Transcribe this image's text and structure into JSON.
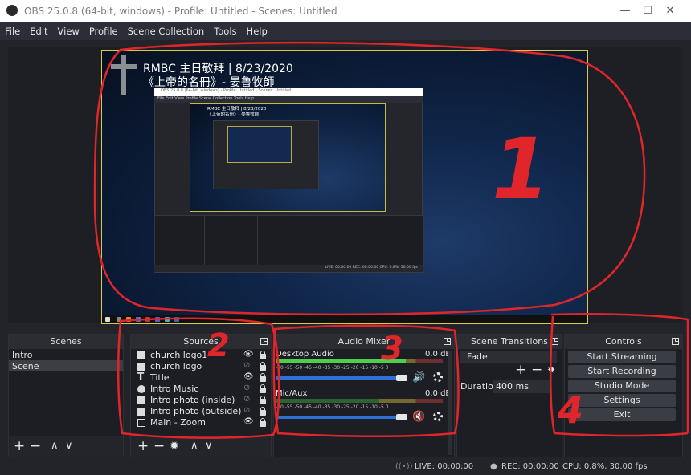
{
  "window": {
    "title": "OBS 25.0.8 (64-bit, windows) - Profile: Untitled - Scenes: Untitled",
    "controls": {
      "minimize": "—",
      "maximize": "☐",
      "close": "✕"
    }
  },
  "menu": [
    "File",
    "Edit",
    "View",
    "Profile",
    "Scene Collection",
    "Tools",
    "Help"
  ],
  "preview": {
    "title_line1": "RMBC 主日敬拜 | 8/23/2020",
    "title_line2": "《上帝的名冊》- 晏鲁牧師",
    "nested": {
      "title": "OBS 25.0.8 (64-bit, windows) - Profile: Untitled - Scenes: Untitled",
      "menu": "File  Edit  View  Profile  Scene Collection  Tools  Help",
      "line1": "RMBC 主日敬拜 | 8/23/2020",
      "line2": "《上帝的名冊》- 晏鲁牧師",
      "status": "LIVE: 00:00:00   REC: 00:00:00   CPU: 0.8%, 30.00 fps"
    }
  },
  "scenes": {
    "header": "Scenes",
    "items": [
      "Intro",
      "Scene"
    ],
    "selected": 1
  },
  "sources": {
    "header": "Sources",
    "items": [
      {
        "name": "church logo1",
        "icon": "image-icon",
        "visible": true
      },
      {
        "name": "church logo",
        "icon": "image-icon",
        "visible": false
      },
      {
        "name": "Title",
        "icon": "text-icon",
        "visible": true
      },
      {
        "name": "Intro Music",
        "icon": "globe-icon",
        "visible": false
      },
      {
        "name": "Intro photo (inside)",
        "icon": "image-icon",
        "visible": false
      },
      {
        "name": "Intro photo (outside)",
        "icon": "image-icon",
        "visible": false
      },
      {
        "name": "Main - Zoom",
        "icon": "monitor-icon",
        "visible": true
      }
    ]
  },
  "audio_mixer": {
    "header": "Audio Mixer",
    "channels": [
      {
        "name": "Desktop Audio",
        "db": "0.0 dB",
        "muted": false,
        "level": 0.78
      },
      {
        "name": "Mic/Aux",
        "db": "0.0 dB",
        "muted": true,
        "level": 0.0
      }
    ],
    "scale": [
      "-60",
      "-55",
      "-50",
      "-45",
      "-40",
      "-35",
      "-30",
      "-25",
      "-20",
      "-15",
      "-10",
      "-5",
      "0"
    ]
  },
  "scene_transitions": {
    "header": "Scene Transitions",
    "transition": "Fade",
    "duration_label": "Duration",
    "duration_value": "400 ms"
  },
  "controls": {
    "header": "Controls",
    "buttons": [
      "Start Streaming",
      "Start Recording",
      "Studio Mode",
      "Settings",
      "Exit"
    ]
  },
  "status": {
    "live": "LIVE: 00:00:00",
    "rec": "REC: 00:00:00",
    "cpu": "CPU: 0.8%, 30.00 fps"
  },
  "annotations": [
    "1",
    "2",
    "3",
    "4"
  ],
  "colors": {
    "annotation": "#e0262a",
    "slider": "#2f6fd6",
    "mute": "#e0262a"
  }
}
